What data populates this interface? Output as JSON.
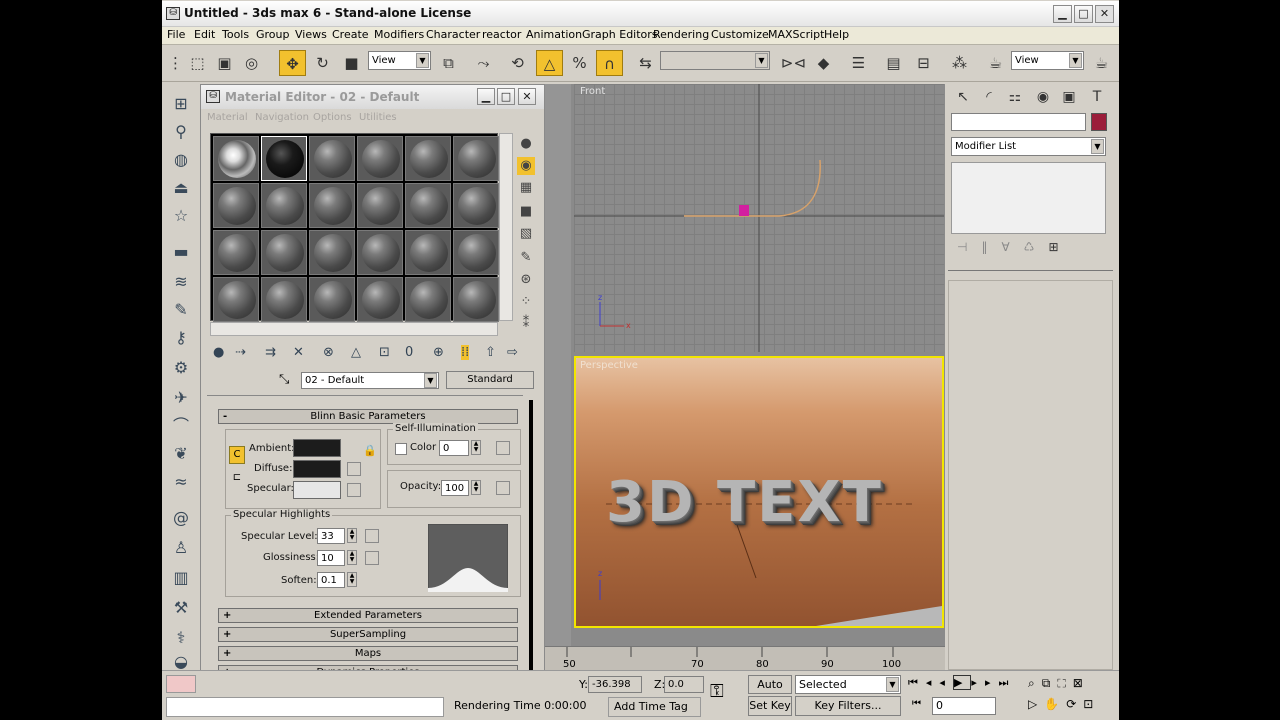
{
  "window": {
    "title": "Untitled - 3ds max 6 - Stand-alone License",
    "app_icon": "3ds-max-icon"
  },
  "menubar": [
    "File",
    "Edit",
    "Tools",
    "Group",
    "Views",
    "Create",
    "Modifiers",
    "Character",
    "reactor",
    "Animation",
    "Graph Editors",
    "Rendering",
    "Customize",
    "MAXScript",
    "Help"
  ],
  "toolbar": {
    "view_select_1": "View",
    "view_select_2": "View"
  },
  "material_editor": {
    "title": "Material Editor - 02 - Default",
    "menu": [
      "Material",
      "Navigation",
      "Options",
      "Utilities"
    ],
    "material_name": "02 - Default",
    "material_type": "Standard",
    "rollout_title": "Blinn Basic Parameters",
    "self_illum_title": "Self-Illumination",
    "color_label": "Color",
    "color_value": "0",
    "ambient_label": "Ambient:",
    "diffuse_label": "Diffuse:",
    "specular_label": "Specular:",
    "opacity_label": "Opacity:",
    "opacity_value": "100",
    "spec_highlights_title": "Specular Highlights",
    "spec_level_label": "Specular Level:",
    "spec_level_value": "33",
    "glossiness_label": "Glossiness:",
    "glossiness_value": "10",
    "soften_label": "Soften:",
    "soften_value": "0.1",
    "rollouts_collapsed": [
      "Extended Parameters",
      "SuperSampling",
      "Maps",
      "Dynamics Properties"
    ],
    "colors": {
      "ambient": "#1c1c1c",
      "diffuse": "#1c1c1c",
      "specular": "#e6e6e6"
    }
  },
  "viewports": {
    "front_label": "Front",
    "perspective_label": "Perspective",
    "scene_text": "3D TEXT"
  },
  "timeline": {
    "ticks": [
      "50",
      "70",
      "80",
      "90",
      "100"
    ]
  },
  "command_panel": {
    "modifier_list": "Modifier List",
    "color_swatch": "#9b1d3a"
  },
  "status": {
    "y_label": "Y:",
    "y_value": "-36.398",
    "z_label": "Z:",
    "z_value": "0.0",
    "auto_key": "Auto Key",
    "key_mode": "Selected",
    "set_key": "Set Key",
    "key_filters": "Key Filters...",
    "frame": "0",
    "rendering_time": "Rendering Time  0:00:00",
    "add_time_tag": "Add Time Tag"
  }
}
